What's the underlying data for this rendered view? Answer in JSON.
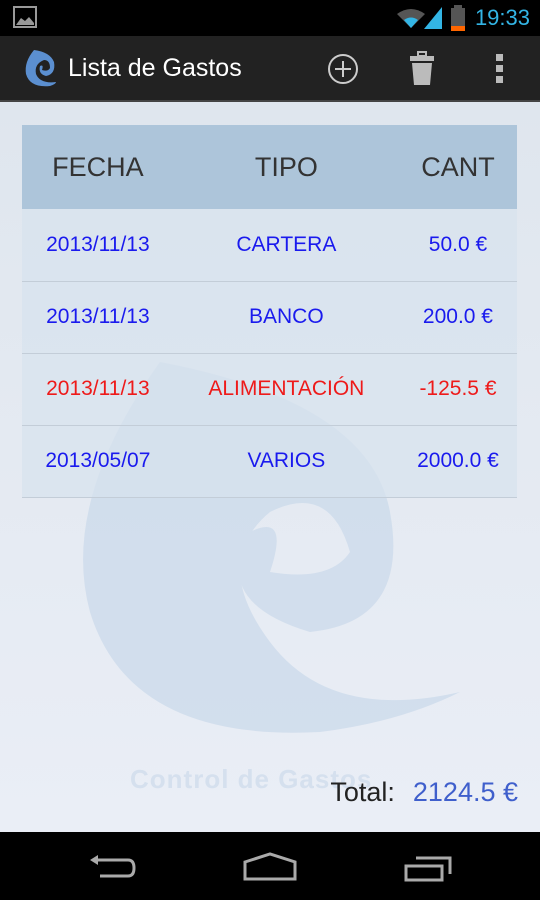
{
  "status_bar": {
    "time": "19:33",
    "icons": [
      "image-notification-icon",
      "wifi-icon",
      "signal-icon",
      "battery-low-icon"
    ]
  },
  "action_bar": {
    "title": "Lista de Gastos",
    "actions": [
      "add-icon",
      "trash-icon",
      "overflow-menu-icon"
    ]
  },
  "table": {
    "headers": [
      "FECHA",
      "TIPO",
      "CANT"
    ],
    "rows": [
      {
        "date": "2013/11/13",
        "type": "CARTERA",
        "amount": "50.0 €"
      },
      {
        "date": "2013/11/13",
        "type": "BANCO",
        "amount": "200.0 €"
      },
      {
        "date": "2013/11/13",
        "type": "ALIMENTACIÓN",
        "amount": "-125.5 €"
      },
      {
        "date": "2013/05/07",
        "type": "VARIOS",
        "amount": "2000.0 €"
      }
    ]
  },
  "watermark": "Control de Gastos",
  "footer": {
    "total_label": "Total:",
    "total_value": "2124.5 €"
  },
  "colors": {
    "positive": "#1a1aee",
    "negative": "#ee1a1a",
    "total": "#3f5fcc",
    "header_bg": "#adc5da"
  }
}
